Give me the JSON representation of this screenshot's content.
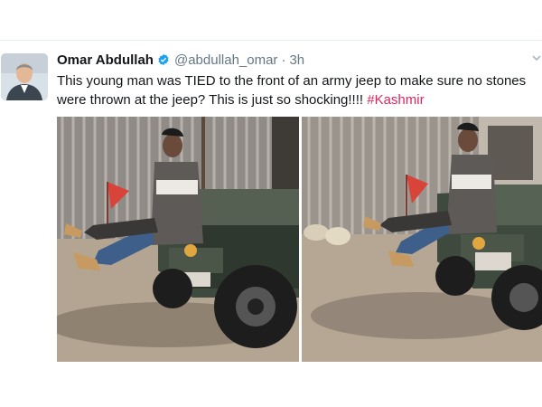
{
  "tweet": {
    "author_name": "Omar Abdullah",
    "handle": "@abdullah_omar",
    "separator": "·",
    "time": "3h",
    "text_main": "This young man was TIED to the front of an army jeep to make sure no stones were thrown at the jeep? This is just so shocking!!!! ",
    "hashtag": "#Kashmir",
    "verified": true,
    "verified_color": "#1da1f2",
    "hashtag_color": "#e0245e",
    "icons": [
      "verified-badge-icon",
      "chevron-down-icon"
    ]
  },
  "media": {
    "photos": [
      {
        "name": "photo-left"
      },
      {
        "name": "photo-right"
      }
    ]
  }
}
